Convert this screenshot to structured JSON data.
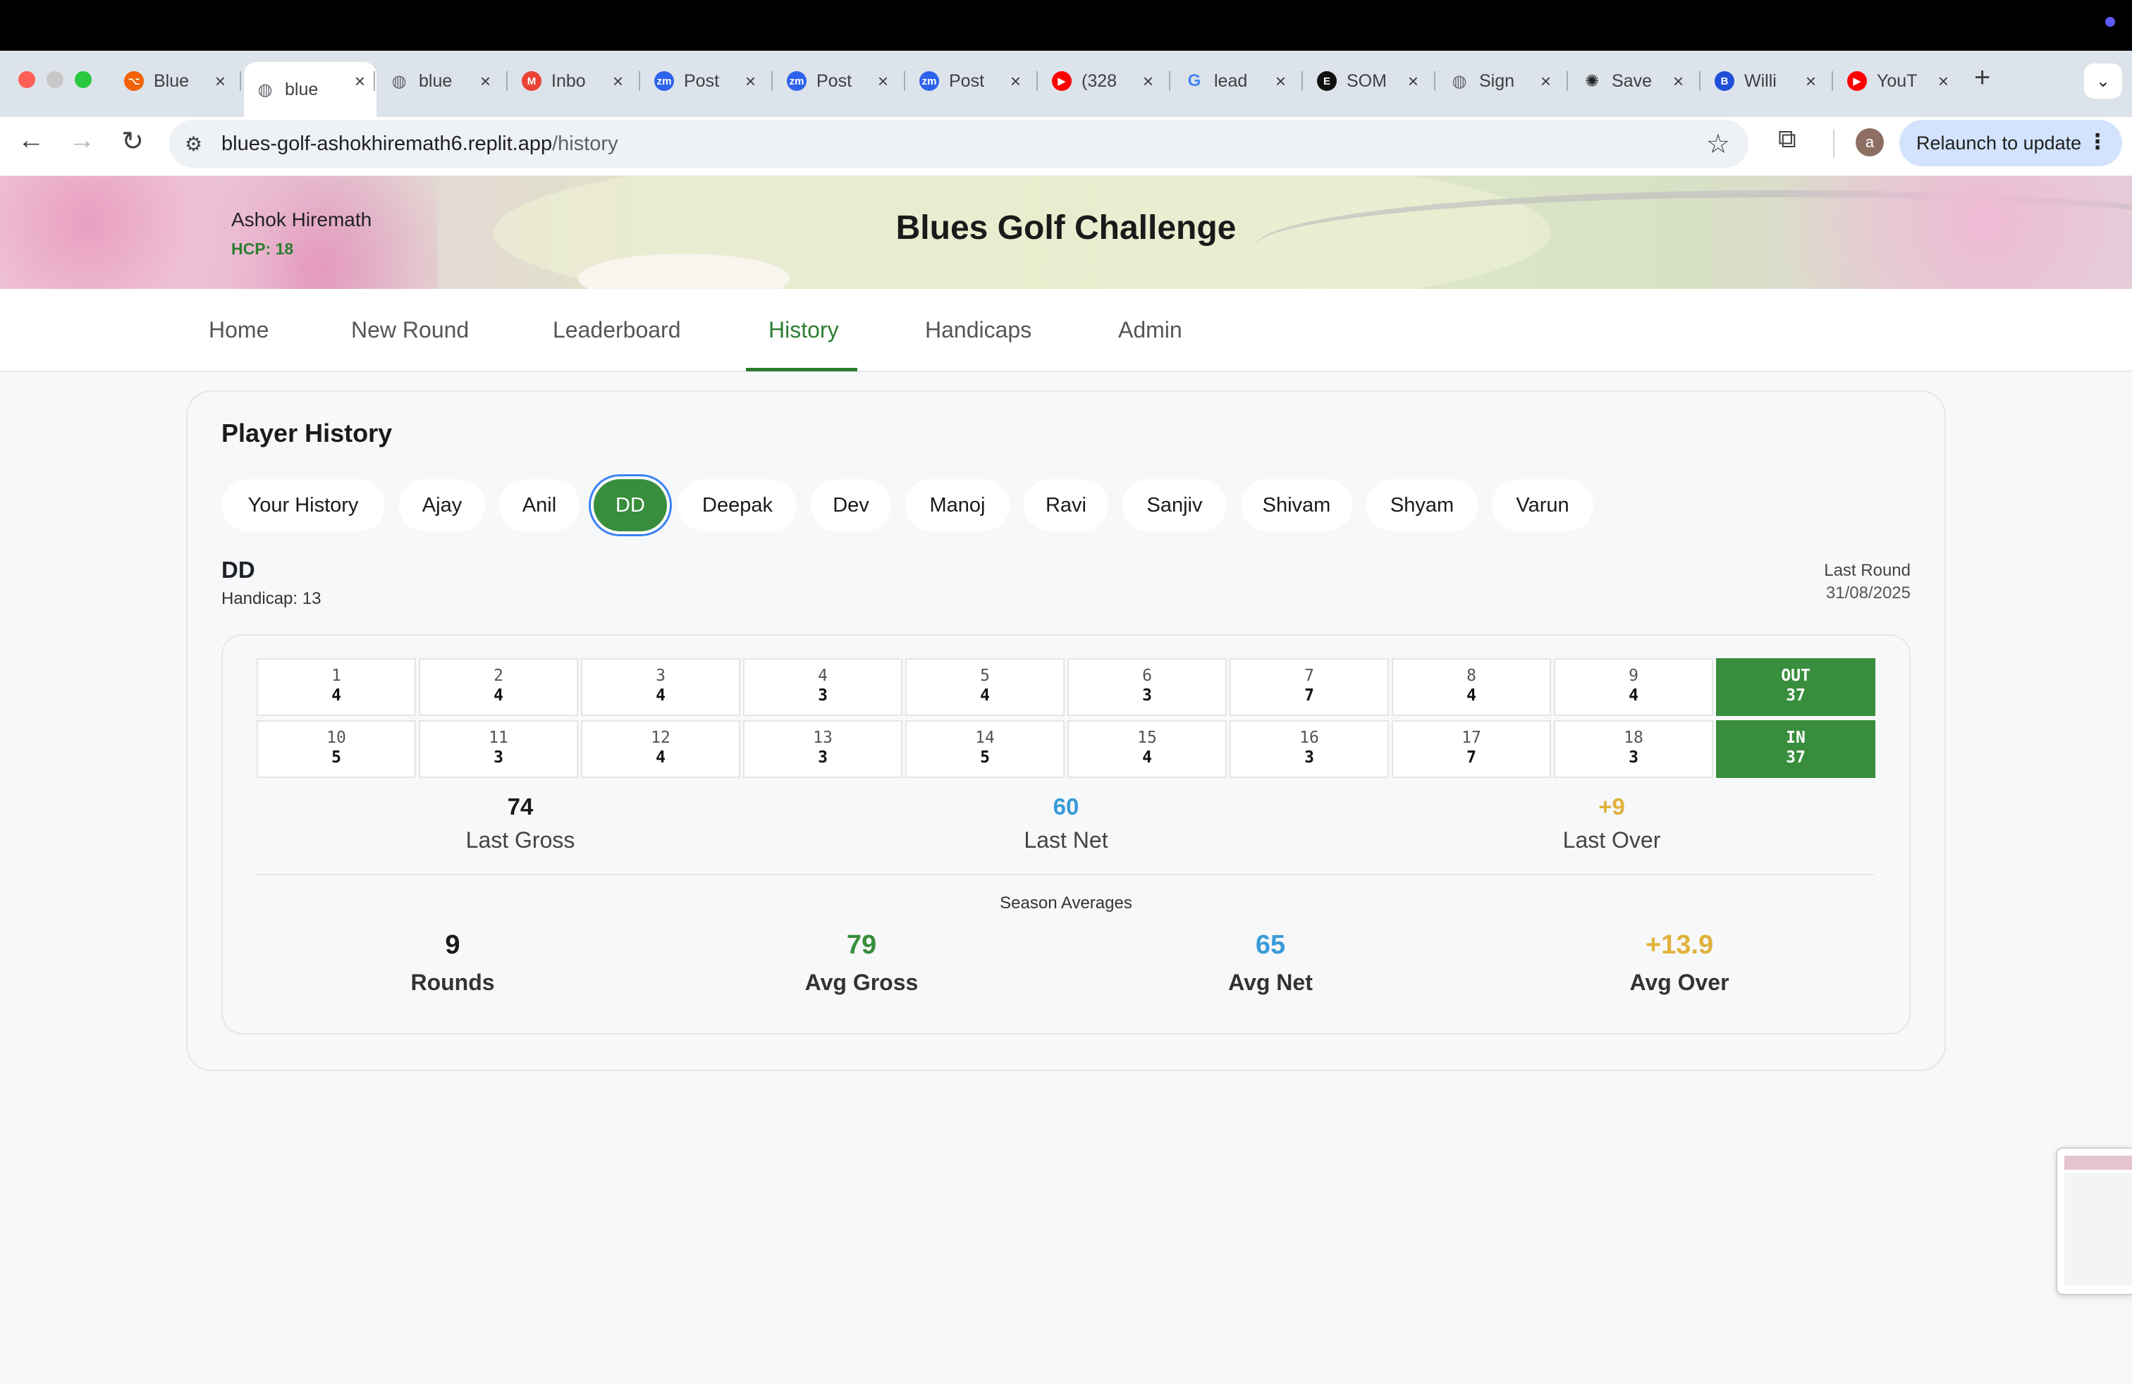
{
  "browser": {
    "tabs": [
      {
        "title": "Blue",
        "icon": "replit-icon",
        "color": "#f26207"
      },
      {
        "title": "blue",
        "icon": "globe-icon",
        "color": "#5f6368",
        "active": true
      },
      {
        "title": "blue",
        "icon": "globe-icon",
        "color": "#5f6368"
      },
      {
        "title": "Inbo",
        "icon": "gmail-icon",
        "color": "#ea4335"
      },
      {
        "title": "Post",
        "icon": "zoom-icon",
        "color": "#2d63ec"
      },
      {
        "title": "Post",
        "icon": "zoom-icon",
        "color": "#2d63ec"
      },
      {
        "title": "Post",
        "icon": "zoom-icon",
        "color": "#2d63ec"
      },
      {
        "title": "(328",
        "icon": "youtube-icon",
        "color": "#ff0000"
      },
      {
        "title": "lead",
        "icon": "google-icon",
        "color": "#4285f4"
      },
      {
        "title": "SOM",
        "icon": "som-icon",
        "color": "#111111"
      },
      {
        "title": "Sign",
        "icon": "globe-icon",
        "color": "#5f6368"
      },
      {
        "title": "Save",
        "icon": "openai-icon",
        "color": "#222222"
      },
      {
        "title": "Willi",
        "icon": "b-icon",
        "color": "#1e4fd8"
      },
      {
        "title": "YouT",
        "icon": "youtube-icon",
        "color": "#ff0000"
      }
    ],
    "url_host": "blues-golf-ashokhiremath6.replit.app",
    "url_path": "/history",
    "relaunch_label": "Relaunch to update",
    "avatar_letter": "a"
  },
  "header": {
    "user_name": "Ashok Hiremath",
    "user_hcp": "HCP: 18",
    "app_title": "Blues Golf Challenge"
  },
  "nav": {
    "items": [
      "Home",
      "New Round",
      "Leaderboard",
      "History",
      "Handicaps",
      "Admin"
    ],
    "active": "History"
  },
  "history": {
    "title": "Player History",
    "players": [
      "Your History",
      "Ajay",
      "Anil",
      "DD",
      "Deepak",
      "Dev",
      "Manoj",
      "Ravi",
      "Sanjiv",
      "Shivam",
      "Shyam",
      "Varun"
    ],
    "selected": "DD",
    "player_name": "DD",
    "player_handicap": "Handicap: 13",
    "last_round_label": "Last Round",
    "last_round_date": "31/08/2025",
    "front_nine": [
      {
        "hole": "1",
        "score": "4"
      },
      {
        "hole": "2",
        "score": "4"
      },
      {
        "hole": "3",
        "score": "4"
      },
      {
        "hole": "4",
        "score": "3"
      },
      {
        "hole": "5",
        "score": "4"
      },
      {
        "hole": "6",
        "score": "3"
      },
      {
        "hole": "7",
        "score": "7"
      },
      {
        "hole": "8",
        "score": "4"
      },
      {
        "hole": "9",
        "score": "4"
      }
    ],
    "out_total": {
      "label": "OUT",
      "score": "37"
    },
    "back_nine": [
      {
        "hole": "10",
        "score": "5"
      },
      {
        "hole": "11",
        "score": "3"
      },
      {
        "hole": "12",
        "score": "4"
      },
      {
        "hole": "13",
        "score": "3"
      },
      {
        "hole": "14",
        "score": "5"
      },
      {
        "hole": "15",
        "score": "4"
      },
      {
        "hole": "16",
        "score": "3"
      },
      {
        "hole": "17",
        "score": "7"
      },
      {
        "hole": "18",
        "score": "3"
      }
    ],
    "in_total": {
      "label": "IN",
      "score": "37"
    },
    "last": {
      "gross": {
        "value": "74",
        "label": "Last Gross"
      },
      "net": {
        "value": "60",
        "label": "Last Net"
      },
      "over": {
        "value": "+9",
        "label": "Last Over"
      }
    },
    "season_title": "Season Averages",
    "season": {
      "rounds": {
        "value": "9",
        "label": "Rounds"
      },
      "avg_gross": {
        "value": "79",
        "label": "Avg Gross"
      },
      "avg_net": {
        "value": "65",
        "label": "Avg Net"
      },
      "avg_over": {
        "value": "+13.9",
        "label": "Avg Over"
      }
    }
  },
  "colors": {
    "accent_green": "#388e3c",
    "net_blue": "#3a9ad9",
    "over_gold": "#e0b23c"
  }
}
